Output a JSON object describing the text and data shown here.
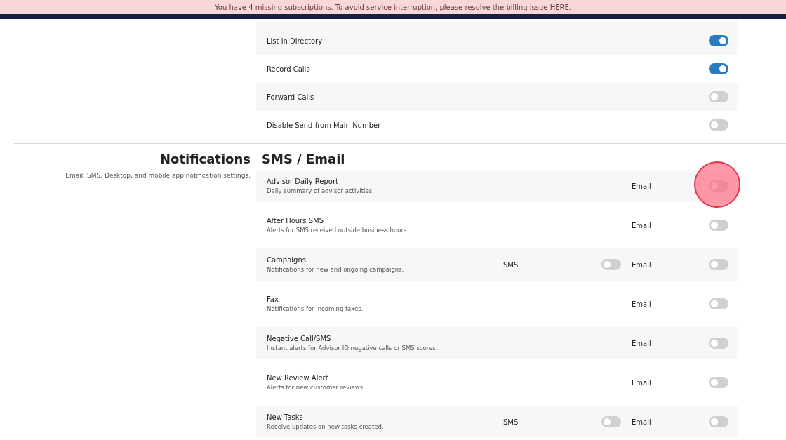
{
  "banner": {
    "message": "You have 4 missing subscriptions. To avoid service interruption, please resolve the billing issue ",
    "link": "HERE",
    "suffix": "."
  },
  "call_settings": [
    {
      "label": "List in Directory",
      "on": true
    },
    {
      "label": "Record Calls",
      "on": true
    },
    {
      "label": "Forward Calls",
      "on": false
    },
    {
      "label": "Disable Send from Main Number",
      "on": false
    }
  ],
  "notifications": {
    "title": "Notifications",
    "description": "Email, SMS, Desktop, and mobile app notification settings.",
    "subtitle": "SMS / Email",
    "items": [
      {
        "name": "Advisor Daily Report",
        "description": "Daily summary of advisor activities.",
        "email_label": "Email",
        "email_on": false,
        "click_highlight": true
      },
      {
        "name": "After Hours SMS",
        "description": "Alerts for SMS received outside business hours.",
        "email_label": "Email",
        "email_on": false,
        "click_highlight": false
      },
      {
        "name": "Campaigns",
        "description": "Notifications for new and ongoing campaigns.",
        "sms_label": "SMS",
        "sms_on": false,
        "email_label": "Email",
        "email_on": false,
        "click_highlight": false
      },
      {
        "name": "Fax",
        "description": "Notifications for incoming faxes.",
        "email_label": "Email",
        "email_on": false,
        "click_highlight": false
      },
      {
        "name": "Negative Call/SMS",
        "description": "Instant alerts for Advisor IQ negative calls or SMS scores.",
        "email_label": "Email",
        "email_on": false,
        "click_highlight": false
      },
      {
        "name": "New Review Alert",
        "description": "Alerts for new customer reviews.",
        "email_label": "Email",
        "email_on": false,
        "click_highlight": false
      },
      {
        "name": "New Tasks",
        "description": "Receive updates on new tasks created.",
        "sms_label": "SMS",
        "sms_on": false,
        "email_label": "Email",
        "email_on": false,
        "click_highlight": false
      }
    ]
  }
}
